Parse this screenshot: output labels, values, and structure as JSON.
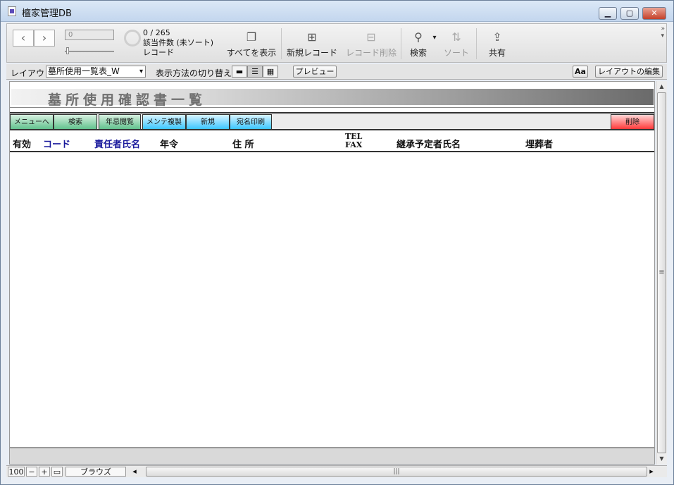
{
  "window": {
    "title": "檀家管理DB"
  },
  "toolbar": {
    "record_value": "0",
    "found_count": "0 / 265",
    "found_label": "該当件数 (未ソート)",
    "record_label": "レコード",
    "show_all": "すべてを表示",
    "new_record": "新規レコード",
    "delete_record": "レコード削除",
    "find": "検索",
    "sort": "ソート",
    "share": "共有"
  },
  "layoutbar": {
    "layout_label": "レイアウト:",
    "layout_value": "墓所使用一覧表_W",
    "view_label": "表示方法の切り替え:",
    "preview": "プレビュー",
    "aa": "Aa",
    "edit_layout": "レイアウトの編集"
  },
  "layout": {
    "header_title": "墓所使用確認書一覧",
    "buttons": {
      "menu": "メニューへ",
      "search": "検索",
      "memorial": "年忌閲覧",
      "maint_copy": "メンテ複製",
      "new": "新規",
      "address_print": "宛名印刷",
      "delete": "削除"
    },
    "columns": {
      "valid": "有効",
      "code": "コード",
      "responsible": "責任者氏名",
      "age": "年令",
      "address": "住 所",
      "tel": "TEL",
      "fax": "FAX",
      "successor": "継承予定者氏名",
      "buried": "埋葬者"
    }
  },
  "status": {
    "zoom": "100",
    "mode": "ブラウズ"
  },
  "colors": {
    "green_button": "#62c28e",
    "blue_button": "#3cc6ff",
    "red_button": "#ff3a3a",
    "blue_header_text": "#1a1a9c"
  }
}
